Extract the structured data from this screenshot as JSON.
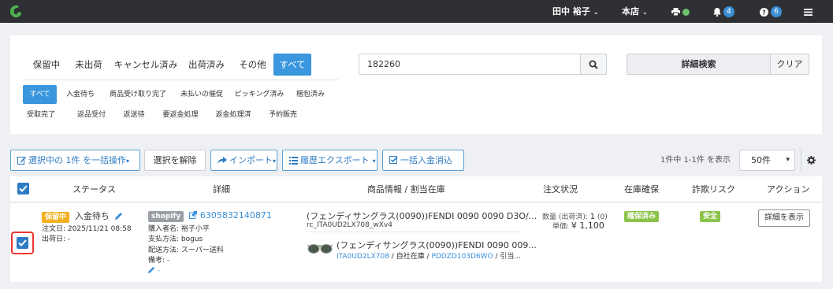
{
  "topbar": {
    "user_name": "田中 裕子",
    "store": "本店",
    "notifications": "4",
    "help_count": "6"
  },
  "status_tabs": [
    "保留中",
    "未出荷",
    "キャンセル済み",
    "出荷済み",
    "その他",
    "すべて"
  ],
  "sub_tabs_row1": [
    "すべて",
    "入金待ち",
    "商品受け取り完了",
    "未払いの催促",
    "ピッキング済み",
    "梱包済み"
  ],
  "sub_tabs_row2": [
    "受取完了",
    "返品受付",
    "返送待",
    "要返金処理",
    "返金処理済",
    "予約販売"
  ],
  "search": {
    "value": "182260",
    "advanced_label": "詳細検索",
    "clear_label": "クリア"
  },
  "toolbar": {
    "bulk_action": "選択中の 1件 を一括操作",
    "deselect": "選択を解除",
    "import": "インポート",
    "history_export": "履歴エクスポート",
    "bulk_payment": "一括入金消込",
    "count_text": "1件中 1-1件 を表示",
    "per_page": "50件"
  },
  "table": {
    "headers": [
      "ステータス",
      "詳細",
      "商品情報 / 割当在庫",
      "注文状況",
      "在庫確保",
      "詐欺リスク",
      "アクション"
    ],
    "row": {
      "status_tag": "保留中",
      "status_text": "入金待ち",
      "order_date_label": "注文日:",
      "order_date": "2025/11/21 08:58",
      "ship_date_label": "出荷日:",
      "ship_date": "-",
      "platform": "shopify",
      "order_id": "6305832140871",
      "buyer_label": "購入者名:",
      "buyer": "裕子小平",
      "payment_label": "支払方法:",
      "payment": "bogus",
      "delivery_label": "配送方法:",
      "delivery": "スーパー送料",
      "note_label": "備考:",
      "note": "-",
      "edit_dash": "-",
      "product_title": "(フェンディサングラス(0090))FENDI 0090 0090 D3O/...",
      "product_code": "rc_ITA0UD2LX708_wXv4",
      "alloc_title": "(フェンディサングラス(0090))FENDI 0090 009...",
      "alloc_code": "ITA0UD2LX708",
      "alloc_mid": " / 自社在庫 / ",
      "alloc_code2": "PDDZD103D6WO",
      "alloc_tail": " / 引当...",
      "qty_label": "数量 (出荷済):",
      "qty_value": "1",
      "qty_shipped": "(0)",
      "price_label": "単価:",
      "price_value": "¥ 1,100",
      "stock_tag": "確保済み",
      "risk_tag": "安全",
      "action": "詳細を表示"
    }
  },
  "colors": {
    "accent": "#3a96dd",
    "topbar": "#2e3034",
    "orange_tag": "#f2b01e",
    "green_tag": "#8bc34a"
  }
}
